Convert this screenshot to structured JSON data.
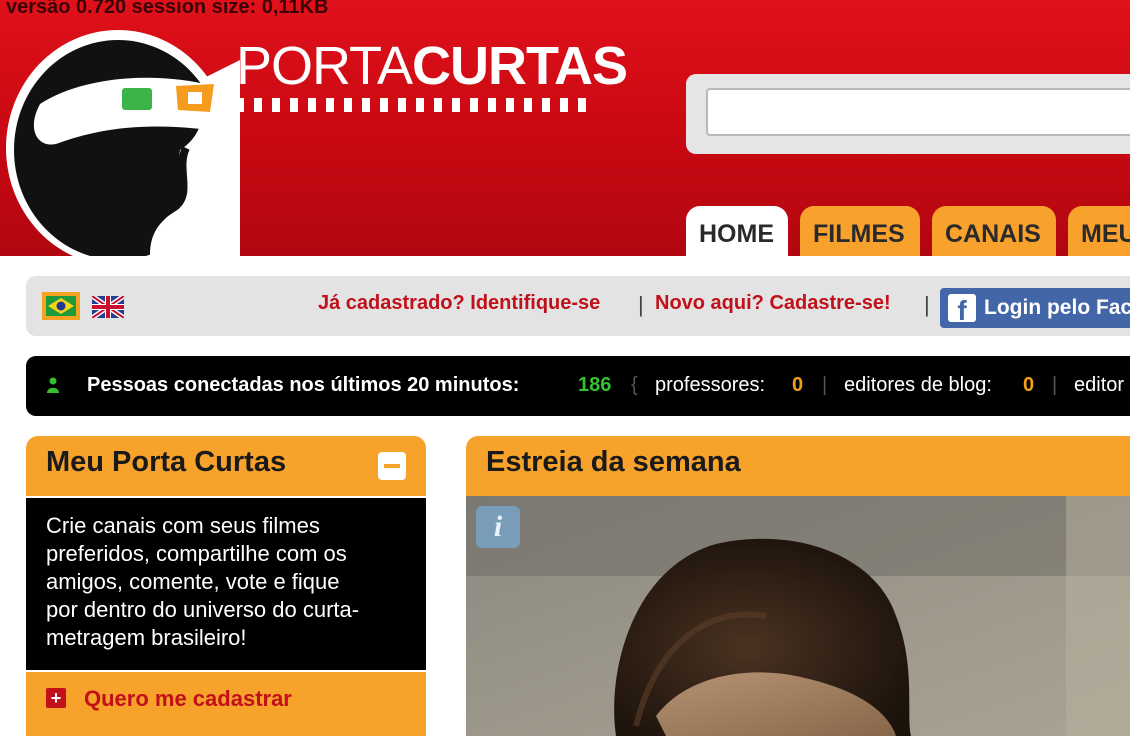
{
  "version_text": "versão 0.720 session size: 0,11KB",
  "logo": {
    "part1": "PORTA",
    "part2": "CURTAS"
  },
  "search": {
    "value": "",
    "placeholder": ""
  },
  "nav": {
    "tabs": [
      {
        "label": "HOME",
        "active": true
      },
      {
        "label": "FILMES",
        "active": false
      },
      {
        "label": "CANAIS",
        "active": false
      },
      {
        "label": "MEU",
        "active": false
      }
    ]
  },
  "user_bar": {
    "languages": [
      {
        "name": "brazil-flag",
        "selected": true
      },
      {
        "name": "uk-flag",
        "selected": false
      }
    ],
    "login_link": "Já cadastrado? Identifique-se",
    "separator": "|",
    "signup_link": "Novo aqui? Cadastre-se!",
    "facebook_button": "Login pelo Fac"
  },
  "online_bar": {
    "label": "Pessoas conectadas nos últimos 20 minutos:",
    "count": "186",
    "brace": "{",
    "professores_label": "professores:",
    "professores_count": "0",
    "sep": "|",
    "editores_label": "editores de blog:",
    "editores_count": "0",
    "editor_cut": "editor"
  },
  "meu_panel": {
    "title": "Meu Porta Curtas",
    "body_lines": [
      "Crie canais com seus filmes",
      "preferidos, compartilhe com os",
      "amigos, comente, vote e fique",
      "por dentro do universo do curta-",
      "metragem brasileiro!"
    ],
    "register_label": "Quero me cadastrar"
  },
  "estreia_panel": {
    "title": "Estreia da semana",
    "info_icon": "i"
  },
  "colors": {
    "header_red": "#c80812",
    "accent_orange": "#f7a22a",
    "link_red": "#c2101a",
    "online_green": "#35c12f",
    "facebook_blue": "#4266a7"
  }
}
